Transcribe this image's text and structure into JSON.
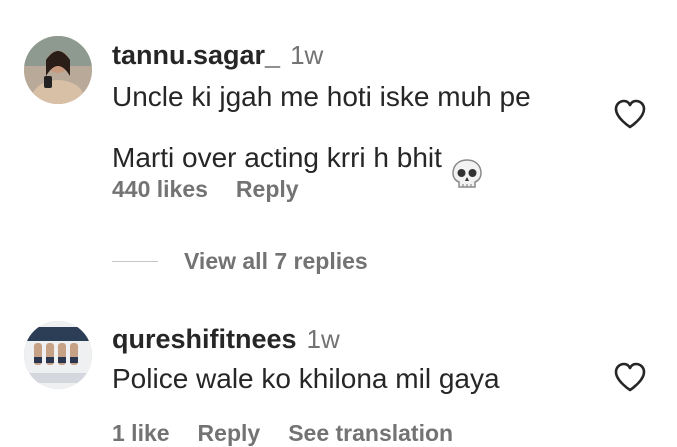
{
  "comments": [
    {
      "username": "tannu.sagar_",
      "time": "1w",
      "text": "Uncle ki jgah me hoti iske muh pe\nMarti over acting krri h bhit",
      "emoji_icon": "skull-icon",
      "actions": [
        "440 likes",
        "Reply"
      ]
    },
    {
      "username": "qureshifitnees",
      "time": "1w",
      "text": "Police wale ko khilona mil gaya",
      "actions": [
        "1 like",
        "Reply",
        "See translation"
      ]
    }
  ],
  "replies": {
    "label": "View all 7 replies"
  },
  "colors": {
    "primary_text": "#262626",
    "secondary_text": "#737373",
    "divider": "#c7c7c7"
  }
}
